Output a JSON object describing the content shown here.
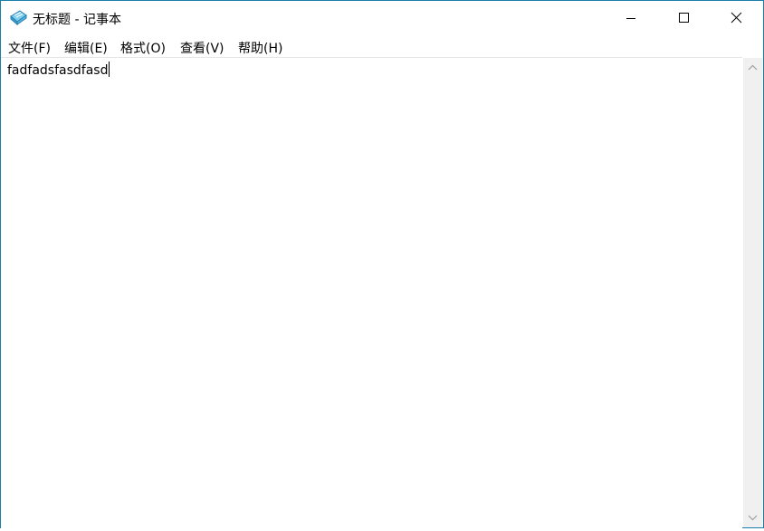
{
  "window": {
    "title": "无标题 - 记事本",
    "accent_border": "#1a7fa8"
  },
  "icons": {
    "app": "notepad-icon",
    "minimize": "minimize-icon",
    "maximize": "maximize-icon",
    "close": "close-icon",
    "scroll_up": "chevron-up-icon",
    "scroll_down": "chevron-down-icon"
  },
  "menu": {
    "file": "文件(F)",
    "edit": "编辑(E)",
    "format": "格式(O)",
    "view": "查看(V)",
    "help": "帮助(H)"
  },
  "editor": {
    "content": "fadfadsfasdfasd"
  }
}
